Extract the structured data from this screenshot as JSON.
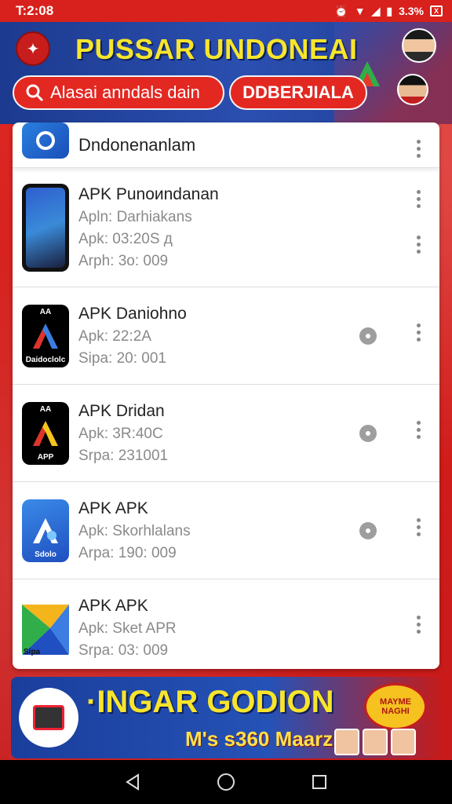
{
  "status_bar": {
    "time": "T:2:08",
    "battery": "3.3%",
    "box_icon_label": "X"
  },
  "header": {
    "title": "PUSSAR UNDONEAI",
    "search_label": "Alasai anndals dain",
    "badge_label": "DDBERJIALA"
  },
  "list": {
    "header_title": "Dndonenanlam",
    "items": [
      {
        "name": "APK Punoиndanan",
        "line1": "Apln: Darhiakans",
        "line2": "Apk: 03:20S д",
        "line3": "Arph: 3o: 009",
        "icon": "phone-icon"
      },
      {
        "name": "APK Daniohno",
        "line1": "Apk: 22:2A",
        "line2": "Sipa: 20: 001",
        "icon_top": "AA",
        "icon_label": "Daidoclolc",
        "icon": "a-logo-blue-icon"
      },
      {
        "name": "APK Dridan",
        "line1": "Apk: 3R:40C",
        "line2": "Srpa: 231001",
        "icon_top": "AA",
        "icon_label": "APP",
        "icon": "a-logo-yellow-icon"
      },
      {
        "name": "APK APK",
        "line1": "Apk: Skorhlalans",
        "line2": "Arpa: 190: 009",
        "icon_label": "Sdolo",
        "icon": "a-logo-light-icon"
      },
      {
        "name": "APK APK",
        "line1": "Apk: Sket APR",
        "line2": "Srpa: 03: 009",
        "icon_label": "Sipa",
        "icon": "play-logo-icon"
      }
    ]
  },
  "promo": {
    "title": "·INGAR GODION",
    "subtitle": "M's s360 Maarz!",
    "badge": "MAYME NAGHI"
  },
  "colors": {
    "brand_red": "#d9231f",
    "header_blue": "#1c3a8f",
    "title_yellow": "#f7e52c"
  }
}
